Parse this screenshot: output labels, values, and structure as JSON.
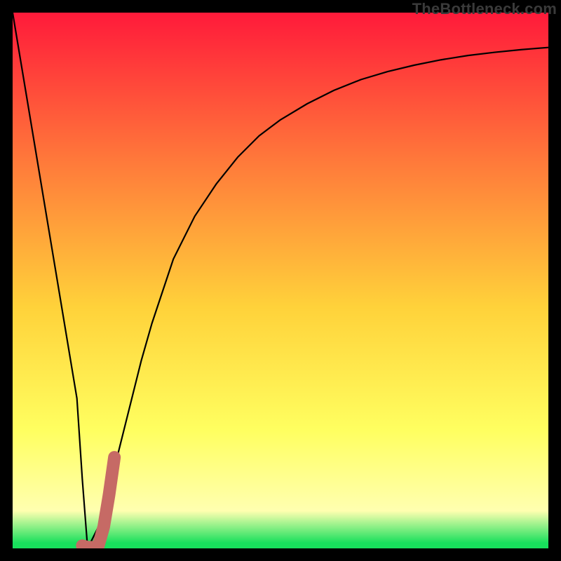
{
  "watermark": "TheBottleneck.com",
  "colors": {
    "frame": "#000000",
    "gradient_top": "#ff1a3a",
    "gradient_mid1": "#ff7a3a",
    "gradient_mid2": "#ffd23a",
    "gradient_mid3": "#ffff60",
    "gradient_bottom_fade": "#ffffb0",
    "gradient_bottom": "#18e05c",
    "curve": "#000000",
    "marker": "#c66a65"
  },
  "chart_data": {
    "type": "line",
    "title": "",
    "xlabel": "",
    "ylabel": "",
    "xlim": [
      0,
      100
    ],
    "ylim": [
      0,
      100
    ],
    "series": [
      {
        "name": "bottleneck-curve",
        "x": [
          0,
          2,
          4,
          6,
          8,
          10,
          12,
          13,
          14,
          16,
          18,
          20,
          22,
          24,
          26,
          28,
          30,
          34,
          38,
          42,
          46,
          50,
          55,
          60,
          65,
          70,
          75,
          80,
          85,
          90,
          95,
          100
        ],
        "y": [
          100,
          88,
          76,
          64,
          52,
          40,
          28,
          13,
          0,
          4,
          11,
          19,
          27,
          35,
          42,
          48,
          54,
          62,
          68,
          73,
          77,
          80,
          83,
          85.5,
          87.5,
          89,
          90.2,
          91.2,
          92,
          92.6,
          93.1,
          93.5
        ]
      },
      {
        "name": "marker-j",
        "x": [
          13,
          14,
          15,
          16,
          17,
          18,
          19
        ],
        "y": [
          0.5,
          0.2,
          0.2,
          0.5,
          4,
          10,
          17
        ]
      }
    ],
    "annotations": []
  }
}
